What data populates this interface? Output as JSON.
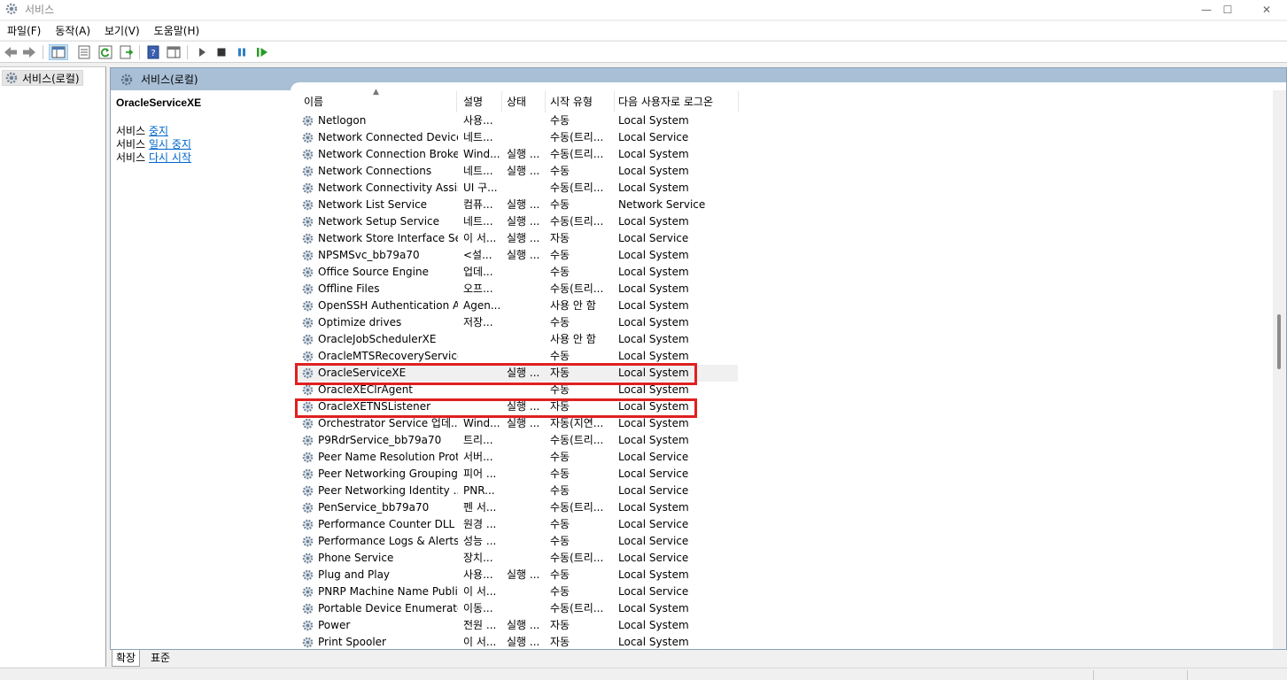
{
  "window": {
    "title": "서비스",
    "minimize_glyph": "—",
    "maximize_glyph": "☐",
    "close_glyph": "✕"
  },
  "menu": [
    "파일(F)",
    "동작(A)",
    "보기(V)",
    "도움말(H)"
  ],
  "toolbar": {
    "icons": [
      "back-icon",
      "forward-icon",
      "show-hide-console-tree-icon",
      "properties-icon",
      "refresh-icon",
      "export-list-icon",
      "help-icon",
      "show-hide-action-pane-icon",
      "start-service-icon",
      "stop-service-icon",
      "pause-service-icon",
      "restart-service-icon"
    ]
  },
  "tree": {
    "selected_node": "서비스(로컬)"
  },
  "panel_header": {
    "title": "서비스(로컬)"
  },
  "extended_pane": {
    "service_name": "OracleServiceXE",
    "actions": [
      {
        "prefix": "서비스 ",
        "link": "중지"
      },
      {
        "prefix": "서비스 ",
        "link": "일시 중지"
      },
      {
        "prefix": "서비스 ",
        "link": "다시 시작"
      }
    ]
  },
  "columns": {
    "name": "이름",
    "description": "설명",
    "status": "상태",
    "startup": "시작 유형",
    "logon": "다음 사용자로 로그온"
  },
  "services": [
    {
      "name": "Netlogon",
      "description": "사용...",
      "status": "",
      "startup": "수동",
      "logon": "Local System"
    },
    {
      "name": "Network Connected Devices...",
      "description": "네트...",
      "status": "",
      "startup": "수동(트리...",
      "logon": "Local Service"
    },
    {
      "name": "Network Connection Broker",
      "description": "Wind...",
      "status": "실행 ...",
      "startup": "수동(트리...",
      "logon": "Local System"
    },
    {
      "name": "Network Connections",
      "description": "네트...",
      "status": "실행 ...",
      "startup": "수동",
      "logon": "Local System"
    },
    {
      "name": "Network Connectivity Assis...",
      "description": "UI 구...",
      "status": "",
      "startup": "수동(트리...",
      "logon": "Local System"
    },
    {
      "name": "Network List Service",
      "description": "컴퓨...",
      "status": "실행 ...",
      "startup": "수동",
      "logon": "Network Service"
    },
    {
      "name": "Network Setup Service",
      "description": "네트...",
      "status": "실행 ...",
      "startup": "수동(트리...",
      "logon": "Local System"
    },
    {
      "name": "Network Store Interface Se...",
      "description": "이 서...",
      "status": "실행 ...",
      "startup": "자동",
      "logon": "Local Service"
    },
    {
      "name": "NPSMSvc_bb79a70",
      "description": "<설...",
      "status": "실행 ...",
      "startup": "수동",
      "logon": "Local System"
    },
    {
      "name": "Office Source Engine",
      "description": "업데...",
      "status": "",
      "startup": "수동",
      "logon": "Local System"
    },
    {
      "name": "Offline Files",
      "description": "오프...",
      "status": "",
      "startup": "수동(트리...",
      "logon": "Local System"
    },
    {
      "name": "OpenSSH Authentication A...",
      "description": "Agen...",
      "status": "",
      "startup": "사용 안 함",
      "logon": "Local System"
    },
    {
      "name": "Optimize drives",
      "description": "저장...",
      "status": "",
      "startup": "수동",
      "logon": "Local System"
    },
    {
      "name": "OracleJobSchedulerXE",
      "description": "",
      "status": "",
      "startup": "사용 안 함",
      "logon": "Local System"
    },
    {
      "name": "OracleMTSRecoveryService",
      "description": "",
      "status": "",
      "startup": "수동",
      "logon": "Local System"
    },
    {
      "name": "OracleServiceXE",
      "description": "",
      "status": "실행 ...",
      "startup": "자동",
      "logon": "Local System"
    },
    {
      "name": "OracleXEClrAgent",
      "description": "",
      "status": "",
      "startup": "수동",
      "logon": "Local System"
    },
    {
      "name": "OracleXETNSListener",
      "description": "",
      "status": "실행 ...",
      "startup": "자동",
      "logon": "Local System"
    },
    {
      "name": "Orchestrator Service 업데...",
      "description": "Wind...",
      "status": "실행 ...",
      "startup": "자동(지연...",
      "logon": "Local System"
    },
    {
      "name": "P9RdrService_bb79a70",
      "description": "트리...",
      "status": "",
      "startup": "수동(트리...",
      "logon": "Local System"
    },
    {
      "name": "Peer Name Resolution Prot...",
      "description": "서버...",
      "status": "",
      "startup": "수동",
      "logon": "Local Service"
    },
    {
      "name": "Peer Networking Grouping",
      "description": "피어 ...",
      "status": "",
      "startup": "수동",
      "logon": "Local Service"
    },
    {
      "name": "Peer Networking Identity ...",
      "description": "PNR...",
      "status": "",
      "startup": "수동",
      "logon": "Local Service"
    },
    {
      "name": "PenService_bb79a70",
      "description": "펜 서...",
      "status": "",
      "startup": "수동(트리...",
      "logon": "Local System"
    },
    {
      "name": "Performance Counter DLL ...",
      "description": "원경 ...",
      "status": "",
      "startup": "수동",
      "logon": "Local Service"
    },
    {
      "name": "Performance Logs & Alerts",
      "description": "성능 ...",
      "status": "",
      "startup": "수동",
      "logon": "Local Service"
    },
    {
      "name": "Phone Service",
      "description": "장치...",
      "status": "",
      "startup": "수동(트리...",
      "logon": "Local Service"
    },
    {
      "name": "Plug and Play",
      "description": "사용...",
      "status": "실행 ...",
      "startup": "수동",
      "logon": "Local System"
    },
    {
      "name": "PNRP Machine Name Publi...",
      "description": "이 서...",
      "status": "",
      "startup": "수동",
      "logon": "Local Service"
    },
    {
      "name": "Portable Device Enumerato...",
      "description": "이동...",
      "status": "",
      "startup": "수동(트리...",
      "logon": "Local System"
    },
    {
      "name": "Power",
      "description": "전원 ...",
      "status": "실행 ...",
      "startup": "자동",
      "logon": "Local System"
    },
    {
      "name": "Print Spooler",
      "description": "이 서...",
      "status": "실행 ...",
      "startup": "자동",
      "logon": "Local System"
    }
  ],
  "selected_service_index": 15,
  "highlighted_service_indices": [
    15,
    17
  ],
  "highlight_color": "#e02020",
  "header_band_color": "#a8bfd6",
  "view_tabs": [
    "확장",
    "표준"
  ]
}
